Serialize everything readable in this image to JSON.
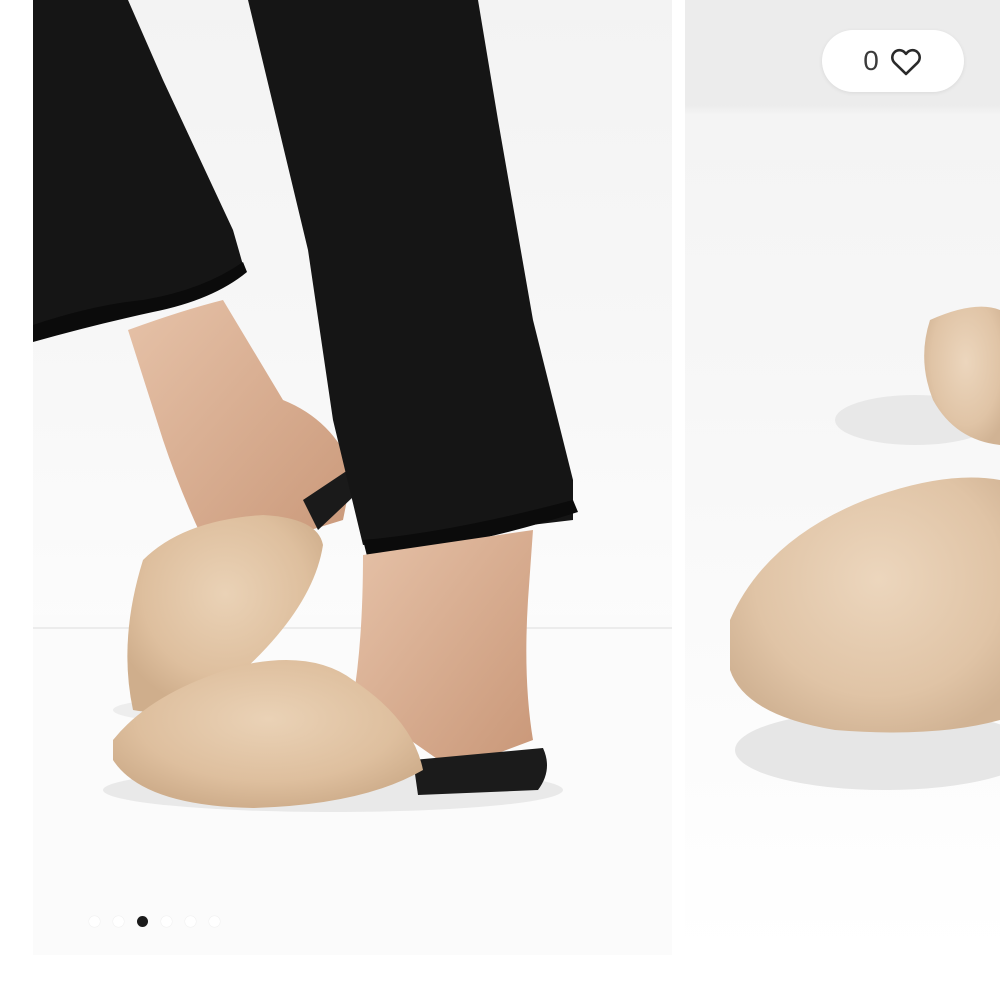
{
  "product_gallery": {
    "slides": [
      {
        "name": "model-wearing-slippers"
      },
      {
        "name": "slipper-closeup"
      }
    ],
    "pager": {
      "dot_count": 6,
      "active_index": 2
    }
  },
  "favorite": {
    "count": "0",
    "icon": "heart-outline-icon"
  },
  "colors": {
    "slipper_fur": "#e2c6a8",
    "denim": "#141414",
    "background": "#f6f6f6"
  }
}
